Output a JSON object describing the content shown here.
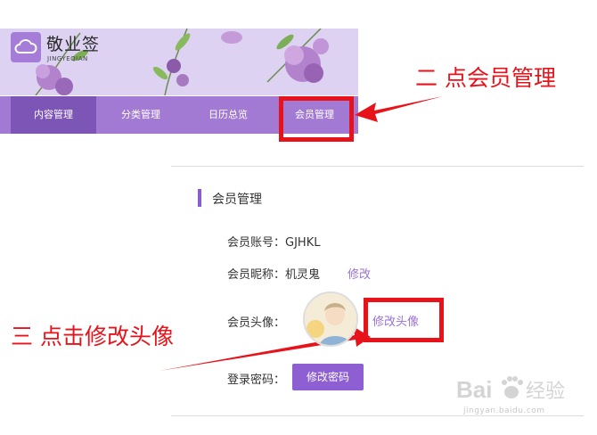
{
  "logo": {
    "title_cn": "敬业签",
    "title_en": "JINGYEQIAN"
  },
  "nav": {
    "items": [
      {
        "label": "内容管理",
        "active": true
      },
      {
        "label": "分类管理",
        "active": false
      },
      {
        "label": "日历总览",
        "active": false
      },
      {
        "label": "会员管理",
        "active": false
      }
    ]
  },
  "annotations": {
    "step2": "二  点会员管理",
    "step3": "三  点击修改头像"
  },
  "section": {
    "title": "会员管理",
    "account_label": "会员账号：",
    "account_value": "GJHKL",
    "nickname_label": "会员昵称：",
    "nickname_value": "机灵鬼",
    "nickname_edit": "修改",
    "avatar_label": "会员头像：",
    "avatar_edit": "修改头像",
    "password_label": "登录密码：",
    "password_button": "修改密码"
  },
  "watermark": {
    "brand": "Bai经验",
    "url": "jingyan.baidu.com"
  },
  "colors": {
    "accent": "#a27ad4",
    "nav_active": "#7d55b6",
    "annotation": "#e8121a",
    "link": "#9a72d0"
  }
}
